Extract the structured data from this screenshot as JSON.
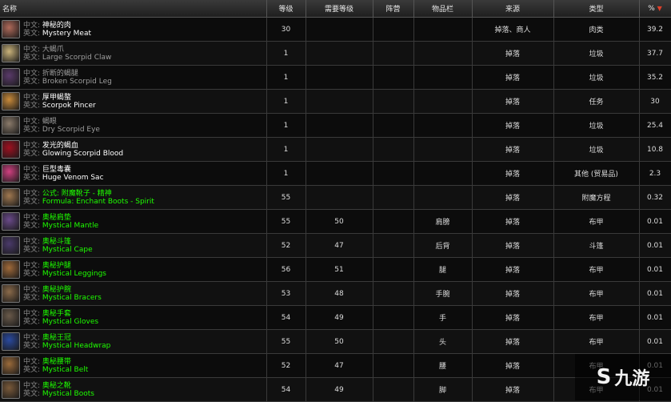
{
  "columns": {
    "name": "名称",
    "level": "等级",
    "req_level": "需要等级",
    "faction": "阵营",
    "slot": "物品栏",
    "source": "来源",
    "type": "类型",
    "pct": "%"
  },
  "labels": {
    "cn": "中文:",
    "en": "英文:"
  },
  "sort_indicator": "▼",
  "items": [
    {
      "cn": "神秘的肉",
      "en": "Mystery Meat",
      "level": "30",
      "req": "",
      "faction": "",
      "slot": "",
      "source": "掉落、商人",
      "type": "肉类",
      "pct": "39.2",
      "quality": "white",
      "icon_color": "#b06a5a"
    },
    {
      "cn": "大蝎爪",
      "en": "Large Scorpid Claw",
      "level": "1",
      "req": "",
      "faction": "",
      "slot": "",
      "source": "掉落",
      "type": "垃圾",
      "pct": "37.7",
      "quality": "gray",
      "icon_color": "#c9b27a"
    },
    {
      "cn": "折断的蝎腿",
      "en": "Broken Scorpid Leg",
      "level": "1",
      "req": "",
      "faction": "",
      "slot": "",
      "source": "掉落",
      "type": "垃圾",
      "pct": "35.2",
      "quality": "gray",
      "icon_color": "#5a3a6a"
    },
    {
      "cn": "厚甲蝎螯",
      "en": "Scorpok Pincer",
      "level": "1",
      "req": "",
      "faction": "",
      "slot": "",
      "source": "掉落",
      "type": "任务",
      "pct": "30",
      "quality": "white",
      "icon_color": "#c98a3a"
    },
    {
      "cn": "蝎眼",
      "en": "Dry Scorpid Eye",
      "level": "1",
      "req": "",
      "faction": "",
      "slot": "",
      "source": "掉落",
      "type": "垃圾",
      "pct": "25.4",
      "quality": "gray",
      "icon_color": "#8a7a6a"
    },
    {
      "cn": "发光的蝎血",
      "en": "Glowing Scorpid Blood",
      "level": "1",
      "req": "",
      "faction": "",
      "slot": "",
      "source": "掉落",
      "type": "垃圾",
      "pct": "10.8",
      "quality": "white",
      "icon_color": "#a01020"
    },
    {
      "cn": "巨型毒囊",
      "en": "Huge Venom Sac",
      "level": "1",
      "req": "",
      "faction": "",
      "slot": "",
      "source": "掉落",
      "type": "其他 (贸易品)",
      "pct": "2.3",
      "quality": "white",
      "icon_color": "#d04080"
    },
    {
      "cn": "公式: 附魔靴子 - 精神",
      "en": "Formula: Enchant Boots - Spirit",
      "level": "55",
      "req": "",
      "faction": "",
      "slot": "",
      "source": "掉落",
      "type": "附魔方程",
      "pct": "0.32",
      "quality": "green",
      "icon_color": "#a07850"
    },
    {
      "cn": "奥秘肩垫",
      "en": "Mystical Mantle",
      "level": "55",
      "req": "50",
      "faction": "",
      "slot": "肩膀",
      "source": "掉落",
      "type": "布甲",
      "pct": "0.01",
      "quality": "green",
      "icon_color": "#6a4a8a"
    },
    {
      "cn": "奥秘斗篷",
      "en": "Mystical Cape",
      "level": "52",
      "req": "47",
      "faction": "",
      "slot": "后背",
      "source": "掉落",
      "type": "斗篷",
      "pct": "0.01",
      "quality": "green",
      "icon_color": "#4a3a6a"
    },
    {
      "cn": "奥秘护腿",
      "en": "Mystical Leggings",
      "level": "56",
      "req": "51",
      "faction": "",
      "slot": "腿",
      "source": "掉落",
      "type": "布甲",
      "pct": "0.01",
      "quality": "green",
      "icon_color": "#a06a3a"
    },
    {
      "cn": "奥秘护腕",
      "en": "Mystical Bracers",
      "level": "53",
      "req": "48",
      "faction": "",
      "slot": "手腕",
      "source": "掉落",
      "type": "布甲",
      "pct": "0.01",
      "quality": "green",
      "icon_color": "#8a6a4a"
    },
    {
      "cn": "奥秘手套",
      "en": "Mystical Gloves",
      "level": "54",
      "req": "49",
      "faction": "",
      "slot": "手",
      "source": "掉落",
      "type": "布甲",
      "pct": "0.01",
      "quality": "green",
      "icon_color": "#6a5a4a"
    },
    {
      "cn": "奥秘王冠",
      "en": "Mystical Headwrap",
      "level": "55",
      "req": "50",
      "faction": "",
      "slot": "头",
      "source": "掉落",
      "type": "布甲",
      "pct": "0.01",
      "quality": "green",
      "icon_color": "#2a4aa0"
    },
    {
      "cn": "奥秘腰带",
      "en": "Mystical Belt",
      "level": "52",
      "req": "47",
      "faction": "",
      "slot": "腰",
      "source": "掉落",
      "type": "布甲",
      "pct": "0.01",
      "quality": "green",
      "icon_color": "#9a6a3a"
    },
    {
      "cn": "奥秘之靴",
      "en": "Mystical Boots",
      "level": "54",
      "req": "49",
      "faction": "",
      "slot": "脚",
      "source": "掉落",
      "type": "布甲",
      "pct": "0.01",
      "quality": "green",
      "icon_color": "#7a5a3a"
    }
  ],
  "watermark": {
    "symbol": "S",
    "text": "九游"
  }
}
